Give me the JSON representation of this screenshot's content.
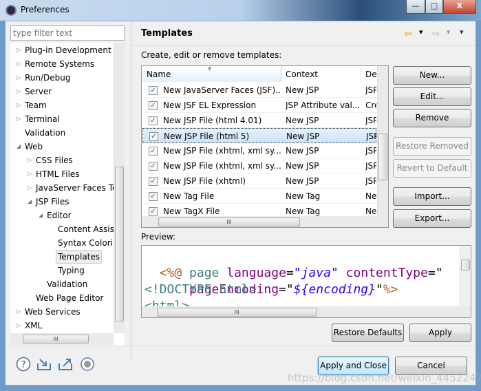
{
  "window": {
    "title": "Preferences",
    "minimize": "—",
    "maximize": "□",
    "close": "X"
  },
  "filter": {
    "placeholder": "type filter text"
  },
  "tree": [
    {
      "label": "Plug-in Development",
      "level": 0,
      "state": "collapsed"
    },
    {
      "label": "Remote Systems",
      "level": 0,
      "state": "collapsed"
    },
    {
      "label": "Run/Debug",
      "level": 0,
      "state": "collapsed"
    },
    {
      "label": "Server",
      "level": 0,
      "state": "collapsed"
    },
    {
      "label": "Team",
      "level": 0,
      "state": "collapsed"
    },
    {
      "label": "Terminal",
      "level": 0,
      "state": "collapsed"
    },
    {
      "label": "Validation",
      "level": 0,
      "state": "leaf"
    },
    {
      "label": "Web",
      "level": 0,
      "state": "expanded"
    },
    {
      "label": "CSS Files",
      "level": 1,
      "state": "collapsed"
    },
    {
      "label": "HTML Files",
      "level": 1,
      "state": "collapsed"
    },
    {
      "label": "JavaServer Faces Tools",
      "level": 1,
      "state": "collapsed"
    },
    {
      "label": "JSP Files",
      "level": 1,
      "state": "expanded"
    },
    {
      "label": "Editor",
      "level": 2,
      "state": "expanded"
    },
    {
      "label": "Content Assist",
      "level": 3,
      "state": "leaf"
    },
    {
      "label": "Syntax Coloring",
      "level": 3,
      "state": "leaf"
    },
    {
      "label": "Templates",
      "level": 3,
      "state": "leaf",
      "selected": true
    },
    {
      "label": "Typing",
      "level": 3,
      "state": "leaf"
    },
    {
      "label": "Validation",
      "level": 2,
      "state": "leaf"
    },
    {
      "label": "Web Page Editor",
      "level": 1,
      "state": "leaf"
    },
    {
      "label": "Web Services",
      "level": 0,
      "state": "collapsed"
    },
    {
      "label": "XML",
      "level": 0,
      "state": "collapsed"
    }
  ],
  "page": {
    "title": "Templates",
    "description": "Create, edit or remove templates:",
    "nav": {
      "back": "⇦",
      "forward": "⇨",
      "menu": "▾"
    }
  },
  "table": {
    "columns": [
      "Name",
      "Context",
      "De"
    ],
    "rows": [
      {
        "checked": true,
        "name": "New JavaServer Faces (JSF)...",
        "context": "New JSP",
        "desc": "JSP"
      },
      {
        "checked": true,
        "name": "New JSF EL Expression",
        "context": "JSP Attribute val...",
        "desc": "Cre"
      },
      {
        "checked": true,
        "name": "New JSP File (html 4.01)",
        "context": "New JSP",
        "desc": "JSP"
      },
      {
        "checked": true,
        "name": "New JSP File (html 5)",
        "context": "New JSP",
        "desc": "JSP",
        "selected": true
      },
      {
        "checked": true,
        "name": "New JSP File (xhtml, xml sy...",
        "context": "New JSP",
        "desc": "JSP"
      },
      {
        "checked": true,
        "name": "New JSP File (xhtml, xml sy...",
        "context": "New JSP",
        "desc": "JSP"
      },
      {
        "checked": true,
        "name": "New JSP File (xhtml)",
        "context": "New JSP",
        "desc": "JSP"
      },
      {
        "checked": true,
        "name": "New Tag File",
        "context": "New Tag",
        "desc": "Ne"
      },
      {
        "checked": true,
        "name": "New TagX File",
        "context": "New Tag",
        "desc": "Ne"
      }
    ]
  },
  "buttons": {
    "new": "New...",
    "edit": "Edit...",
    "remove": "Remove",
    "restore_removed": "Restore Removed",
    "revert": "Revert to Default",
    "import": "Import...",
    "export": "Export...",
    "restore_defaults": "Restore Defaults",
    "apply": "Apply",
    "apply_close": "Apply and Close",
    "cancel": "Cancel"
  },
  "preview": {
    "label": "Preview:",
    "line1": {
      "a": "<%@",
      "b": " page",
      "c": " language",
      "d": "=",
      "e": "\"java\"",
      "f": " contentType",
      "g": "=\""
    },
    "line2": {
      "a": "    pageEncoding",
      "b": "=\"",
      "c": "${encoding}",
      "d": "\"",
      "e": "%>"
    },
    "line3": "<!DOCTYPE html>",
    "line4": "<html>"
  },
  "colors": {
    "tag": "#b85c1e",
    "attr": "#7f007f",
    "string": "#2a00ff",
    "keyword": "#3f7f7f"
  },
  "watermark": "https://blog.csdn.net/weixin_44522477"
}
